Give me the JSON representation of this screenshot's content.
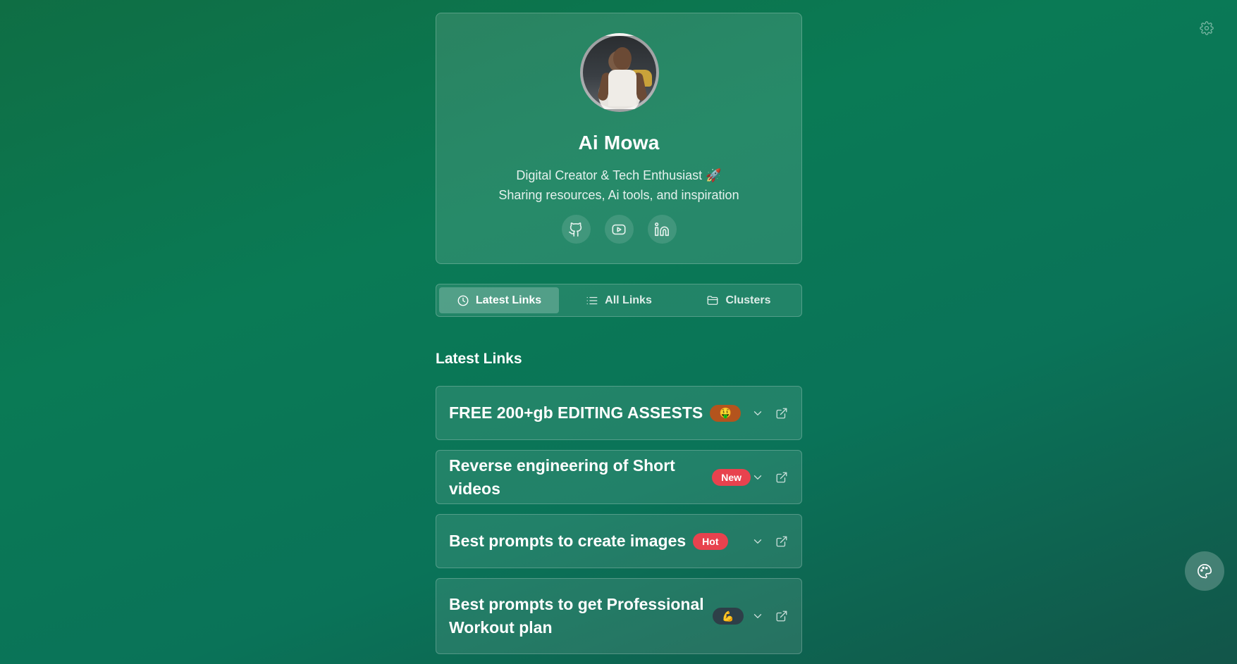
{
  "profile": {
    "name": "Ai Mowa",
    "bio_line1": "Digital Creator & Tech Enthusiast 🚀",
    "bio_line2": "Sharing resources, Ai tools, and inspiration",
    "socials": [
      {
        "icon": "github-icon"
      },
      {
        "icon": "youtube-icon"
      },
      {
        "icon": "linkedin-icon"
      }
    ]
  },
  "tabs": [
    {
      "label": "Latest Links",
      "icon": "clock-icon",
      "active": true
    },
    {
      "label": "All Links",
      "icon": "list-icon",
      "active": false
    },
    {
      "label": "Clusters",
      "icon": "folder-icon",
      "active": false
    }
  ],
  "section": {
    "title": "Latest Links"
  },
  "links": [
    {
      "title": "FREE 200+gb EDITING ASSESTS",
      "badge": "🤑",
      "badge_color": "#b4541d"
    },
    {
      "title": "Reverse engineering of Short videos",
      "badge": "New",
      "badge_color": "#e8424e"
    },
    {
      "title": "Best prompts to create images",
      "badge": "Hot",
      "badge_color": "#e8424e"
    },
    {
      "title": "Best prompts to get Professional Workout plan",
      "badge": "💪",
      "badge_color": "#2e3f48"
    }
  ],
  "colors": {
    "background_start": "#0f6e44",
    "background_end": "#125549",
    "badge_red": "#e8424e"
  }
}
